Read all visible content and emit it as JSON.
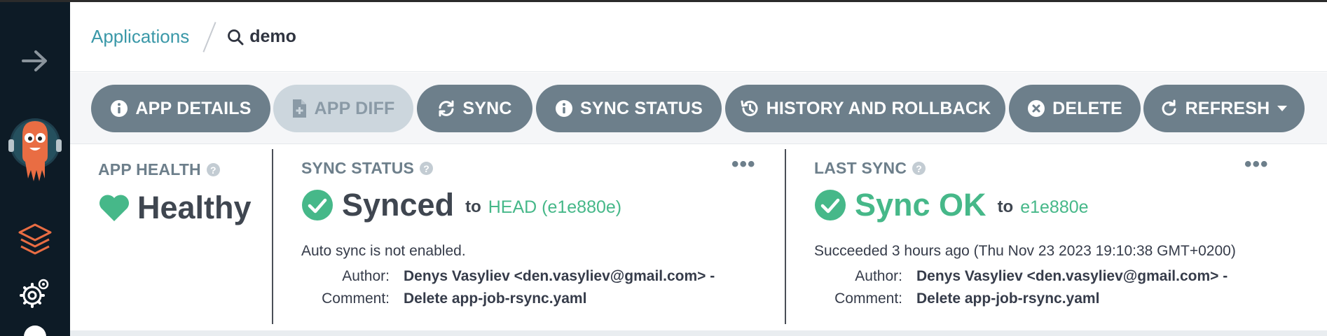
{
  "colors": {
    "sidebar": "#0d1b26",
    "button": "#6d7f8b",
    "button_disabled": "#ccd6dd",
    "accent_teal": "#3a98a8",
    "status_green": "#46b889",
    "argo_orange": "#e96d43"
  },
  "breadcrumb": {
    "applications_label": "Applications",
    "search_text": "demo"
  },
  "toolbar": {
    "app_details": "APP DETAILS",
    "app_diff": "APP DIFF",
    "sync": "SYNC",
    "sync_status": "SYNC STATUS",
    "history": "HISTORY AND ROLLBACK",
    "delete": "DELETE",
    "refresh": "REFRESH"
  },
  "app_health": {
    "title": "APP HEALTH",
    "status": "Healthy"
  },
  "sync_status": {
    "title": "SYNC STATUS",
    "status": "Synced",
    "to_label": "to",
    "revision": "HEAD (e1e880e)",
    "message": "Auto sync is not enabled.",
    "author_label": "Author:",
    "author": "Denys Vasyliev <den.vasyliev@gmail.com> -",
    "comment_label": "Comment:",
    "comment": "Delete app-job-rsync.yaml"
  },
  "last_sync": {
    "title": "LAST SYNC",
    "status": "Sync OK",
    "to_label": "to",
    "revision": "e1e880e",
    "message": "Succeeded 3 hours ago (Thu Nov 23 2023 19:10:38 GMT+0200)",
    "author_label": "Author:",
    "author": "Denys Vasyliev <den.vasyliev@gmail.com> -",
    "comment_label": "Comment:",
    "comment": "Delete app-job-rsync.yaml"
  },
  "icons": [
    "arrow-right-icon",
    "argo-logo",
    "layers-icon",
    "gears-icon",
    "search-icon",
    "info-icon",
    "file-plus-icon",
    "sync-icon",
    "history-icon",
    "times-circle-icon",
    "redo-icon",
    "caret-down-icon",
    "help-icon",
    "heart-icon",
    "check-circle-icon",
    "more-dots-icon"
  ]
}
